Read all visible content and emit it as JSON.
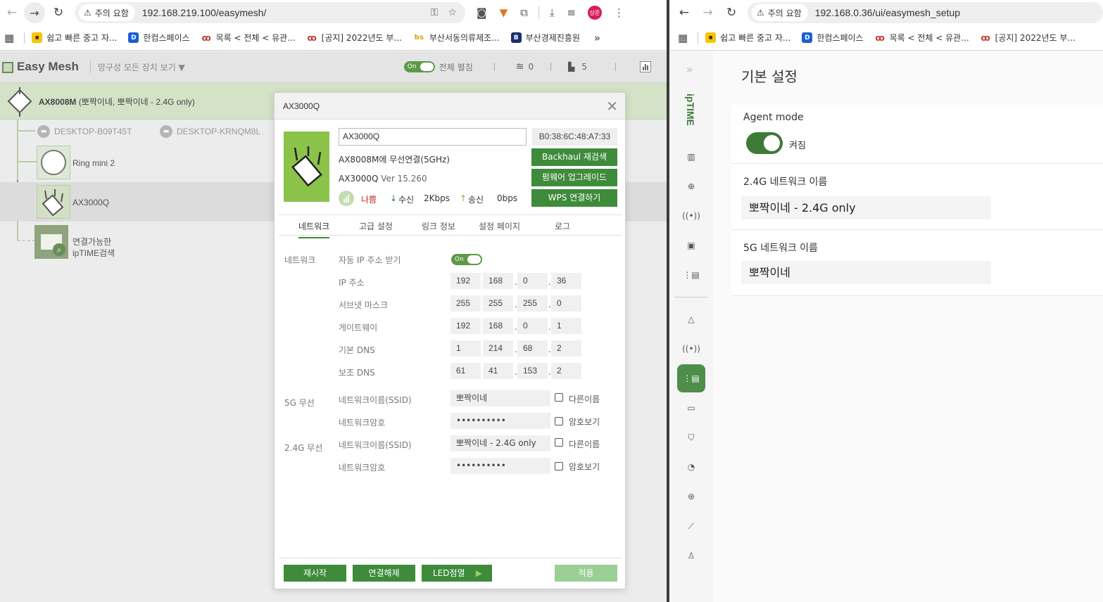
{
  "left_browser": {
    "security_chip": "주의 요함",
    "url": "192.168.219.100/easymesh/",
    "bookmarks": [
      "쉽고 빠른 중고 자...",
      "한컴스페이스",
      "목록 < 전체 < 유관...",
      "[공지] 2022년도 부...",
      "부산서동의류제조...",
      "부산경제진흥원"
    ],
    "more_label": "»"
  },
  "right_browser": {
    "security_chip": "주의 요함",
    "url": "192.168.0.36/ui/easymesh_setup",
    "bookmarks": [
      "쉽고 빠른 중고 자...",
      "한컴스페이스",
      "목록 < 전체 < 유관...",
      "[공지] 2022년도 부..."
    ]
  },
  "easymesh": {
    "logo": "Easy Mesh",
    "view_select": "망구성 모든 장치 보기 ▼",
    "toggle_on": "On",
    "expand_all": "전체 펼침",
    "wifi_count": "0",
    "device_count": "5",
    "root_name": "AX8008M",
    "root_ssids": "(뽀짝이네, 뽀짝이네 - 2.4G only)",
    "pc1": "DESKTOP-B09T45T",
    "pc2": "DESKTOP-KRNQM8L",
    "child1": "Ring mini 2",
    "child2": "AX3000Q",
    "search_label_1": "연결가능한",
    "search_label_2": "ipTIME검색"
  },
  "modal": {
    "title": "AX3000Q",
    "name_value": "AX3000Q",
    "mac": "B0:38:6C:48:A7:33",
    "connection": "AX8008M에 무선연결(5GHz)",
    "model": "AX3000Q",
    "version": "Ver 15.260",
    "signal": "나쁨",
    "rx_label": "수신",
    "rx_value": "2Kbps",
    "tx_label": "송신",
    "tx_value": "0bps",
    "btn_backhaul": "Backhaul 재검색",
    "btn_firmware": "펌웨어 업그레이드",
    "btn_wps": "WPS 연결하기",
    "tabs": [
      "네트워크",
      "고급 설정",
      "링크 정보",
      "설정 페이지",
      "로그"
    ],
    "sec_network": "네트워크",
    "auto_ip": "자동 IP 주소 받기",
    "toggle_on": "On",
    "ip_label": "IP 주소",
    "ip": [
      "192",
      "168",
      "0",
      "36"
    ],
    "subnet_label": "서브넷 마스크",
    "subnet": [
      "255",
      "255",
      "255",
      "0"
    ],
    "gateway_label": "게이트웨이",
    "gateway": [
      "192",
      "168",
      "0",
      "1"
    ],
    "dns1_label": "기본 DNS",
    "dns1": [
      "1",
      "214",
      "68",
      "2"
    ],
    "dns2_label": "보조 DNS",
    "dns2": [
      "61",
      "41",
      "153",
      "2"
    ],
    "sec_5g": "5G 무선",
    "sec_24g": "2.4G 무선",
    "ssid_label": "네트워크이름(SSID)",
    "pw_label": "네트워크암호",
    "ssid_5g": "뽀짝이네",
    "pw_5g": "••••••••••",
    "ssid_24g": "뽀짝이네 - 2.4G only",
    "pw_24g": "••••••••••",
    "diff_name": "다른이름",
    "show_pw": "암호보기",
    "btn_restart": "재시작",
    "btn_disconnect": "연결해제",
    "btn_led": "LED점멸",
    "btn_apply": "적용"
  },
  "iptime": {
    "brand": "ipTIME",
    "page_title": "기본 설정",
    "agent_mode_label": "Agent mode",
    "agent_mode_state": "켜짐",
    "net24_label": "2.4G 네트워크 이름",
    "net24_value": "뽀짝이네 - 2.4G only",
    "net5_label": "5G 네트워크 이름",
    "net5_value": "뽀짝이네"
  },
  "colors": {
    "accent_green": "#3e8b3b",
    "selected_row": "#d4e3c8",
    "toggle_dark": "#3e7a37"
  }
}
